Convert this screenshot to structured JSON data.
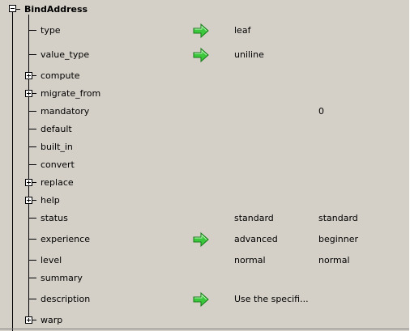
{
  "root": {
    "label": "BindAddress",
    "expanded": true
  },
  "rows": [
    {
      "name": "type",
      "label": "type",
      "expandable": false,
      "arrow": true,
      "value": "leaf",
      "default": ""
    },
    {
      "name": "value-type",
      "label": "value_type",
      "expandable": false,
      "arrow": true,
      "value": "uniline",
      "default": ""
    },
    {
      "name": "compute",
      "label": "compute",
      "expandable": true,
      "arrow": false,
      "value": "",
      "default": ""
    },
    {
      "name": "migrate-from",
      "label": "migrate_from",
      "expandable": true,
      "arrow": false,
      "value": "",
      "default": ""
    },
    {
      "name": "mandatory",
      "label": "mandatory",
      "expandable": false,
      "arrow": false,
      "value": "",
      "default": "0"
    },
    {
      "name": "default",
      "label": "default",
      "expandable": false,
      "arrow": false,
      "value": "",
      "default": ""
    },
    {
      "name": "built-in",
      "label": "built_in",
      "expandable": false,
      "arrow": false,
      "value": "",
      "default": ""
    },
    {
      "name": "convert",
      "label": "convert",
      "expandable": false,
      "arrow": false,
      "value": "",
      "default": ""
    },
    {
      "name": "replace",
      "label": "replace",
      "expandable": true,
      "arrow": false,
      "value": "",
      "default": ""
    },
    {
      "name": "help",
      "label": "help",
      "expandable": true,
      "arrow": false,
      "value": "",
      "default": ""
    },
    {
      "name": "status",
      "label": "status",
      "expandable": false,
      "arrow": false,
      "value": "standard",
      "default": "standard"
    },
    {
      "name": "experience",
      "label": "experience",
      "expandable": false,
      "arrow": true,
      "value": "advanced",
      "default": "beginner"
    },
    {
      "name": "level",
      "label": "level",
      "expandable": false,
      "arrow": false,
      "value": "normal",
      "default": "normal"
    },
    {
      "name": "summary",
      "label": "summary",
      "expandable": false,
      "arrow": false,
      "value": "",
      "default": ""
    },
    {
      "name": "description",
      "label": "description",
      "expandable": false,
      "arrow": true,
      "value": "Use the specifi...",
      "default": ""
    },
    {
      "name": "warp",
      "label": "warp",
      "expandable": true,
      "arrow": false,
      "value": "",
      "default": ""
    }
  ],
  "icons": {
    "arrow": "green-right-arrow-icon",
    "expand": "plus-box-icon",
    "collapse": "minus-box-icon"
  },
  "colors": {
    "background": "#d4d0c8",
    "arrow_fill": "#3cc83c",
    "arrow_stroke": "#1a7a1a"
  }
}
